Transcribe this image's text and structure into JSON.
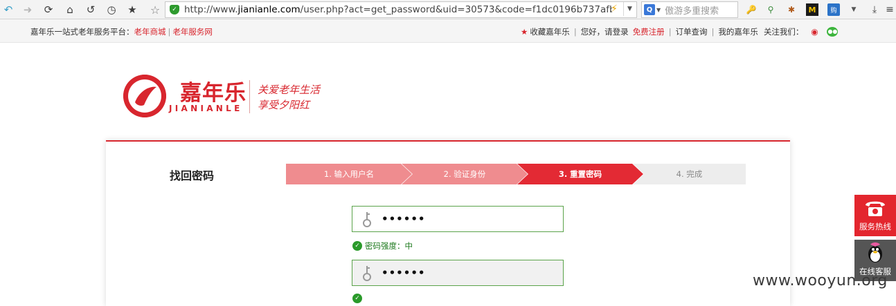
{
  "browser": {
    "url_prefix": "http://www.",
    "url_host": "jianianle.com",
    "url_path": "/user.php?act=get_password&uid=30573&code=f1dc0196b737afb",
    "search_placeholder": "傲游多重搜索",
    "search_engine_glyph": "Q",
    "ext_m_glyph": "M",
    "ext_box_glyph": "购",
    "icons": [
      "back-icon",
      "forward-icon",
      "reload-icon",
      "home-icon",
      "undo-icon",
      "history-icon",
      "bookmark-star-icon",
      "add-favorite-icon",
      "secure-shield-icon",
      "bolt-icon",
      "search-engine-icon",
      "key-icon",
      "sniffer-icon",
      "bug-icon",
      "m-extension-icon",
      "shopping-extension-icon",
      "download-icon",
      "menu-icon"
    ]
  },
  "topbar": {
    "intro": "嘉年乐一站式老年服务平台：",
    "link_mall": "老年商城",
    "separator": "|",
    "link_service": "老年服务网",
    "favorite": "收藏嘉年乐",
    "greeting": "您好，请登录",
    "register": "免费注册",
    "order_query": "订单查询",
    "my_account": "我的嘉年乐",
    "follow_us": "关注我们："
  },
  "logo": {
    "brand_cn": "嘉年乐",
    "brand_en": "JIANIANLE",
    "slogan_line1": "关爱老年生活",
    "slogan_line2": "享受夕阳红"
  },
  "page": {
    "title": "找回密码",
    "steps": [
      {
        "label": "1. 输入用户名",
        "state": "done"
      },
      {
        "label": "2. 验证身份",
        "state": "done"
      },
      {
        "label": "3. 重置密码",
        "state": "active"
      },
      {
        "label": "4. 完成",
        "state": "todo"
      }
    ],
    "password_value": "••••••",
    "password_strength": "密码强度：中",
    "confirm_value": "••••••"
  },
  "side": {
    "hotline": "服务热线",
    "online_service": "在线客服"
  },
  "watermark": "www.wooyun.org",
  "colors": {
    "brand_red": "#d8262e",
    "step_done": "#ef8c8f",
    "step_active": "#e32a34",
    "step_todo": "#ededed",
    "valid_green": "#2a9a2a"
  }
}
